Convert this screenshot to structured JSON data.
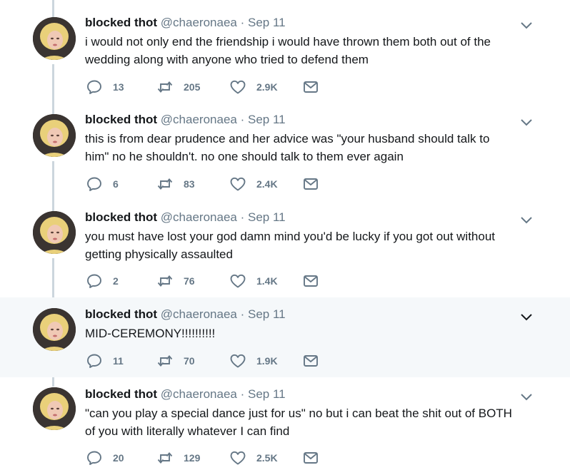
{
  "tweets": [
    {
      "name": "blocked thot",
      "handle": "@chaeronaea",
      "sep": "·",
      "date": "Sep 11",
      "text": "i would not only end the friendship i would have thrown them both out of the\nwedding along with anyone who tried to defend them",
      "replies": "13",
      "retweets": "205",
      "likes": "2.9K"
    },
    {
      "name": "blocked thot",
      "handle": "@chaeronaea",
      "sep": "·",
      "date": "Sep 11",
      "text": "this is from dear prudence and her advice was \"your husband should talk to\nhim\" no he shouldn't. no one should talk to them ever again",
      "replies": "6",
      "retweets": "83",
      "likes": "2.4K"
    },
    {
      "name": "blocked thot",
      "handle": "@chaeronaea",
      "sep": "·",
      "date": "Sep 11",
      "text": "you must have lost your god damn mind you'd be lucky if you got out without\ngetting physically assaulted",
      "replies": "2",
      "retweets": "76",
      "likes": "1.4K"
    },
    {
      "name": "blocked thot",
      "handle": "@chaeronaea",
      "sep": "·",
      "date": "Sep 11",
      "text": "MID-CEREMONY!!!!!!!!!!",
      "replies": "11",
      "retweets": "70",
      "likes": "1.9K"
    },
    {
      "name": "blocked thot",
      "handle": "@chaeronaea",
      "sep": "·",
      "date": "Sep 11",
      "text": "\"can you play a special dance just for us\" no but i can beat the shit out of BOTH\nof you with literally whatever I can find",
      "replies": "20",
      "retweets": "129",
      "likes": "2.5K"
    }
  ],
  "icons": {
    "reply": "reply-icon",
    "retweet": "retweet-icon",
    "like": "heart-icon",
    "message": "envelope-icon",
    "more": "chevron-down-icon"
  },
  "colors": {
    "icon": "#657786",
    "thread_line": "#ccd6dd",
    "highlight": "#f5f8fa"
  }
}
